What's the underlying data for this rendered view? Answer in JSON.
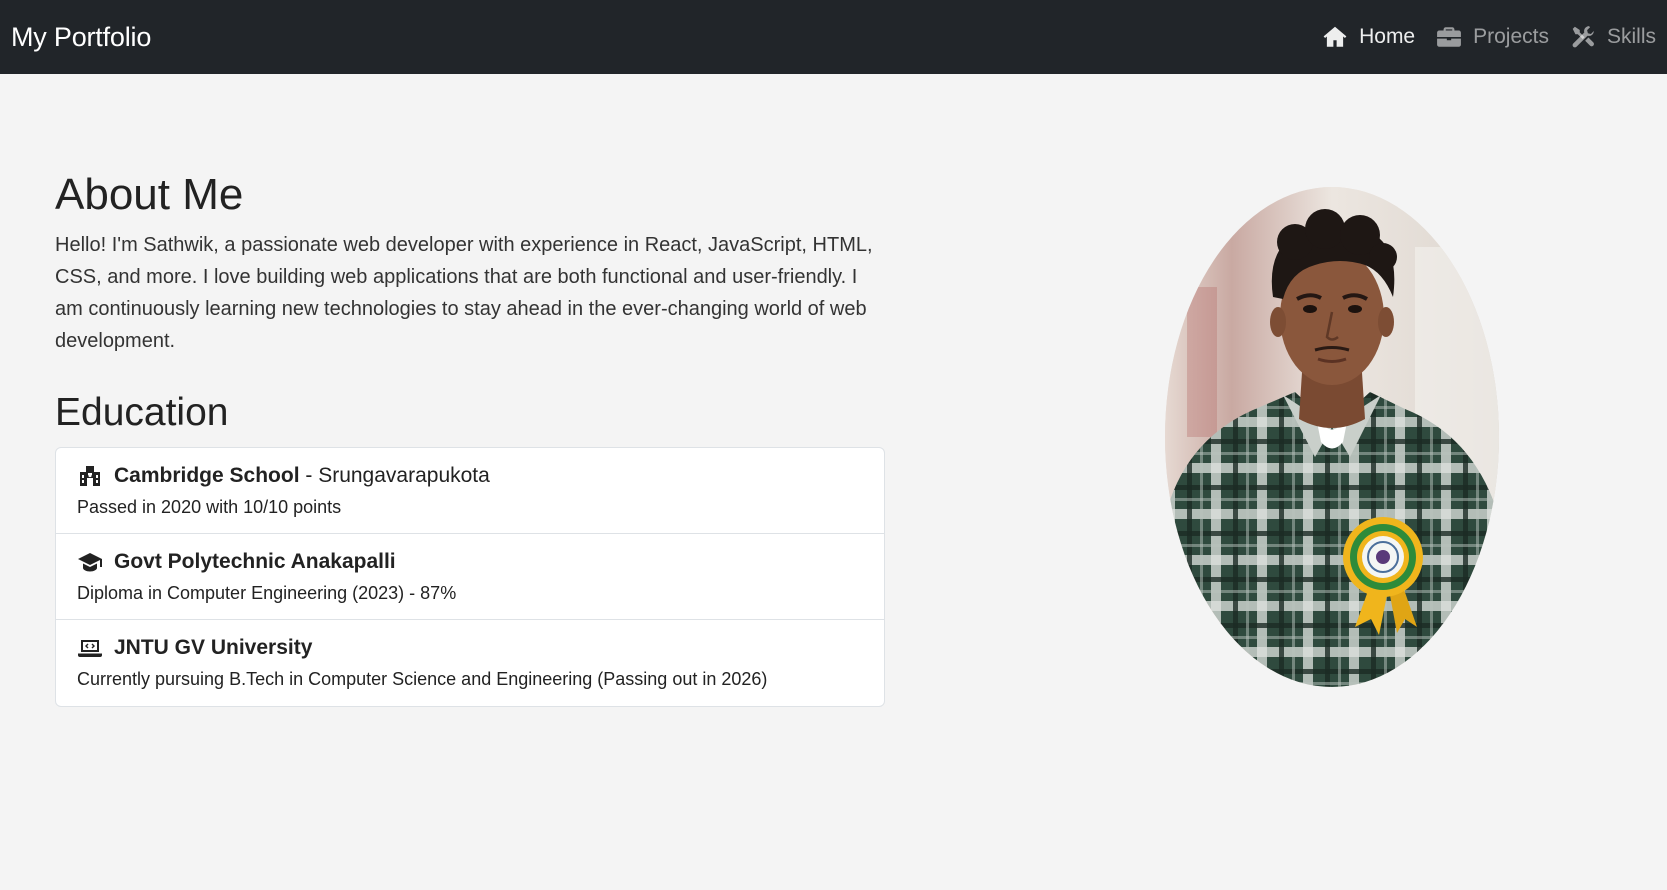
{
  "navbar": {
    "brand": "My Portfolio",
    "links": [
      {
        "label": "Home",
        "icon": "home-icon",
        "active": true
      },
      {
        "label": "Projects",
        "icon": "briefcase-icon",
        "active": false
      },
      {
        "label": "Skills",
        "icon": "tools-icon",
        "active": false
      }
    ]
  },
  "about": {
    "heading": "About Me",
    "text": "Hello! I'm Sathwik, a passionate web developer with experience in React, JavaScript, HTML, CSS, and more. I love building web applications that are both functional and user-friendly. I am continuously learning new technologies to stay ahead in the ever-changing world of web development."
  },
  "education": {
    "heading": "Education",
    "items": [
      {
        "icon": "school-icon",
        "name": "Cambridge School",
        "separator": " - ",
        "location": "Srungavarapukota",
        "detail": "Passed in 2020 with 10/10 points"
      },
      {
        "icon": "graduation-cap-icon",
        "name": "Govt Polytechnic Anakapalli",
        "separator": "",
        "location": "",
        "detail": "Diploma in Computer Engineering (2023) - 87%"
      },
      {
        "icon": "laptop-code-icon",
        "name": "JNTU GV University",
        "separator": "",
        "location": "",
        "detail": "Currently pursuing B.Tech in Computer Science and Engineering (Passing out in 2026)"
      }
    ]
  },
  "profile_photo": {
    "icon": "profile-photo"
  },
  "colors": {
    "navbar_bg": "#212529",
    "page_bg": "#f4f4f4",
    "shirt_green": "#2f4a3e",
    "rosette_green": "#2e8b3a",
    "rosette_yellow": "#f0b51c"
  }
}
